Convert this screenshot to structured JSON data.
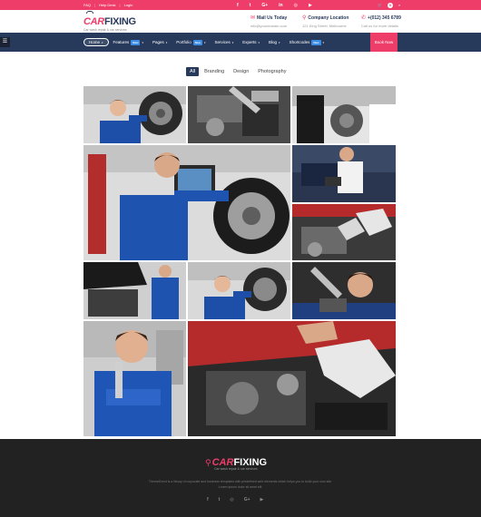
{
  "topbar": {
    "links": [
      "FAQ",
      "Help Desk",
      "Login"
    ],
    "social": [
      "f",
      "t",
      "G+",
      "in",
      "◎",
      "▶"
    ],
    "cart_count": "0"
  },
  "header": {
    "logo_car": "CAR",
    "logo_fix": "FIXING",
    "logo_tag": "Car wash repair & car services",
    "mail_title": "Mail Us Today",
    "mail_value": "info@yourdomain.com",
    "location_title": "Company Location",
    "location_value": "121 King Street, Melbourne",
    "phone_title": "+(012) 345 6789",
    "phone_value": "Call us for more details"
  },
  "nav": {
    "items": [
      {
        "label": "Home",
        "badge": ""
      },
      {
        "label": "Features",
        "badge": "New"
      },
      {
        "label": "Pages",
        "badge": ""
      },
      {
        "label": "Portfolio",
        "badge": "New"
      },
      {
        "label": "Services",
        "badge": ""
      },
      {
        "label": "Experts",
        "badge": ""
      },
      {
        "label": "Blog",
        "badge": ""
      },
      {
        "label": "Shortcodes",
        "badge": "New"
      }
    ],
    "book_label": "Book Now"
  },
  "filters": [
    "All",
    "Branding",
    "Design",
    "Photography"
  ],
  "footer": {
    "logo_car": "CAR",
    "logo_fix": "FIXING",
    "logo_tag": "Car wash repair & car services",
    "description": "ThemeEvent is a library of corporate and business templates with predefined web elements which helps you to build your own site. Lorem ipsum dolor sit amet elit.",
    "social": [
      "f",
      "t",
      "◎",
      "G+",
      "▶"
    ]
  },
  "colors": {
    "accent": "#ef3d6a",
    "navy": "#283a5b",
    "footer": "#222222"
  }
}
